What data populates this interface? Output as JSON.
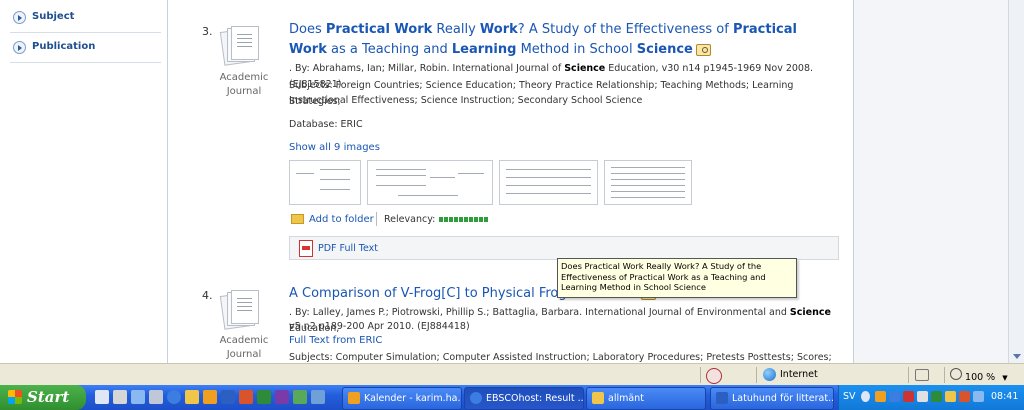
{
  "facets": [
    {
      "label": "Subject"
    },
    {
      "label": "Publication"
    }
  ],
  "results": [
    {
      "number": "3.",
      "pub_type": "Academic Journal",
      "title_parts": [
        "Does ",
        "Practical Work",
        " Really ",
        "Work",
        "? A Study of the Effectiveness of ",
        "Practical Work",
        " as a Teaching and ",
        "Learning",
        " Method in School ",
        "Science"
      ],
      "byline": ". By: Abrahams, Ian; Millar, Robin. International Journal of ",
      "byline_bold": "Science",
      "byline_end": " Education, v30 n14 p1945-1969 Nov 2008. (EJ815821)",
      "subjects_line1": "Subjects: Foreign Countries; Science Education; Theory Practice Relationship; Teaching Methods; Learning Strategies;",
      "subjects_line2": "Instructional Effectiveness; Science Instruction; Secondary School Science",
      "database": "Database: ERIC",
      "show_images": "Show all 9 images",
      "add_to_folder": "Add to folder",
      "relevancy_label": "Relevancy:",
      "relevancy_level": 1.0,
      "pdf_label": "PDF Full Text"
    },
    {
      "number": "4.",
      "pub_type": "Academic Journal",
      "title": "A Comparison of V-Frog[C] to Physical Frog Dissection",
      "byline": ". By: Lalley, James P.; Piotrowski, Phillip S.; Battaglia, Barbara. International Journal of Environmental and ",
      "byline_bold": "Science",
      "byline_end": " Education,",
      "byline_line2": "v5 n2 p189-200 Apr 2010. (EJ884418)",
      "fulltext_link": "Full Text from ERIC",
      "subjects_line1": "Subjects: Computer Simulation; Computer Assisted Instruction; Laboratory Procedures; Pretests Posttests; Scores; Anatomy;"
    }
  ],
  "tooltip": "Does Practical Work Really Work? A Study of the Effectiveness of Practical Work as a Teaching and Learning Method in School Science",
  "statusbar": {
    "zone": "Internet",
    "zoom": "100 %"
  },
  "taskbar": {
    "start": "Start",
    "tasks": [
      {
        "label": "Kalender - karim.ha...",
        "icon_color": "#f0a020"
      },
      {
        "label": "EBSCOhost: Result ...",
        "icon_color": "#3b7de0"
      },
      {
        "label": "allmänt",
        "icon_color": "#f0c64a"
      },
      {
        "label": "Latuhund för litterat...",
        "icon_color": "#2b5fc2"
      }
    ],
    "language": "SV",
    "clock": "08:41"
  }
}
